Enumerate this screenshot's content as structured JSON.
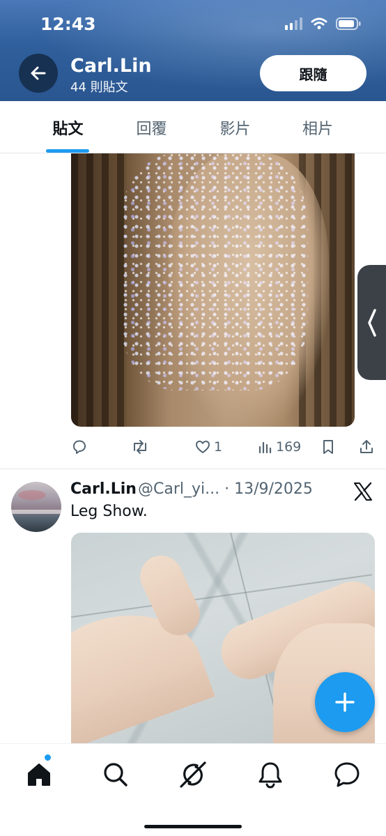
{
  "status_bar": {
    "time": "12:43"
  },
  "header": {
    "name": "Carl.Lin",
    "post_count": "44 則貼文",
    "follow_label": "跟隨"
  },
  "tabs": [
    {
      "label": "貼文",
      "active": true
    },
    {
      "label": "回覆",
      "active": false
    },
    {
      "label": "影片",
      "active": false
    },
    {
      "label": "相片",
      "active": false
    }
  ],
  "post1": {
    "actions": {
      "reply_count": "",
      "repost_count": "",
      "like_count": "1",
      "view_count": "169"
    }
  },
  "post2": {
    "author_name": "Carl.Lin",
    "meta": "@Carl_yi... · 13/9/2025",
    "text": "Leg Show."
  },
  "colors": {
    "accent": "#1d9bf0",
    "text_primary": "#0f1419",
    "text_secondary": "#536471",
    "banner": "#2f5f9c"
  },
  "icons": [
    "back-arrow-icon",
    "reply-icon",
    "repost-icon",
    "like-icon",
    "views-icon",
    "bookmark-icon",
    "share-icon",
    "x-logo-icon",
    "plus-icon",
    "home-icon",
    "search-icon",
    "grok-icon",
    "bell-icon",
    "messages-icon"
  ]
}
